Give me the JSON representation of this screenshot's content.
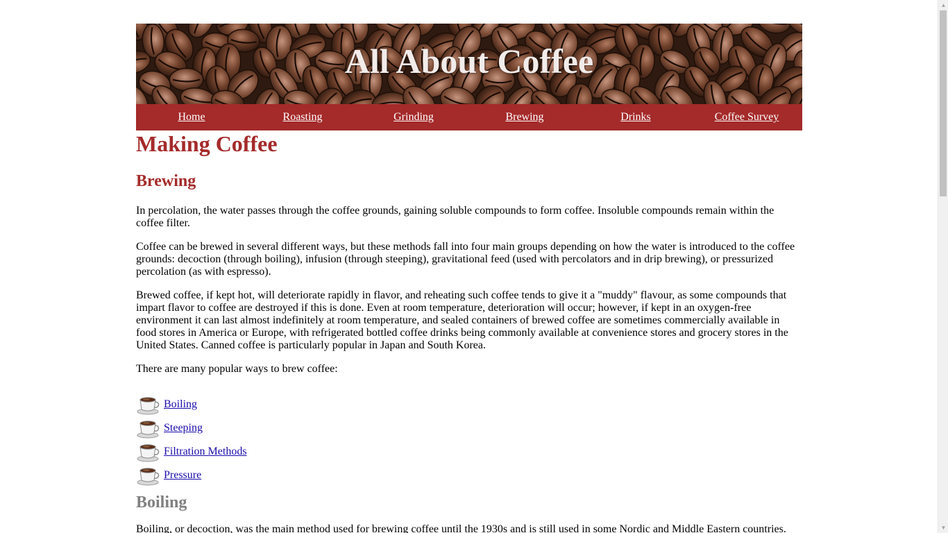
{
  "header": {
    "title": "All About Coffee"
  },
  "nav": {
    "items": [
      {
        "label": "Home"
      },
      {
        "label": "Roasting"
      },
      {
        "label": "Grinding"
      },
      {
        "label": "Brewing"
      },
      {
        "label": "Drinks"
      },
      {
        "label": "Coffee Survey"
      }
    ]
  },
  "main": {
    "title": "Making Coffee",
    "section_heading": "Brewing",
    "paragraphs": [
      "In percolation, the water passes through the coffee grounds, gaining soluble compounds to form coffee. Insoluble compounds remain within the coffee filter.",
      "Coffee can be brewed in several different ways, but these methods fall into four main groups depending on how the water is introduced to the coffee grounds: decoction (through boiling), infusion (through steeping), gravitational feed (used with percolators and in drip brewing), or pressurized percolation (as with espresso).",
      "Brewed coffee, if kept hot, will deteriorate rapidly in flavor, and reheating such coffee tends to give it a \"muddy\" flavour, as some compounds that impart flavor to coffee are destroyed if this is done. Even at room temperature, deterioration will occur; however, if kept in an oxygen-free environment it can last almost indefinitely at room temperature, and sealed containers of brewed coffee are sometimes commercially available in food stores in America or Europe, with refrigerated bottled coffee drinks being commonly available at convenience stores and grocery stores in the United States. Canned coffee is particularly popular in Japan and South Korea.",
      "There are many popular ways to brew coffee:"
    ],
    "methods": [
      {
        "label": "Boiling",
        "icon": "coffee-cup-icon"
      },
      {
        "label": "Steeping",
        "icon": "coffee-cup-icon"
      },
      {
        "label": "Filtration Methods",
        "icon": "coffee-cup-icon"
      },
      {
        "label": "Pressure",
        "icon": "coffee-cup-icon"
      }
    ],
    "subsection_heading": "Boiling",
    "subsection_text": "Boiling, or decoction, was the main method used for brewing coffee until the 1930s and is still used in some Nordic and Middle Eastern countries."
  },
  "colors": {
    "accent": "#a52a2a",
    "nav_text": "#ffffff",
    "link": "#1a0dab",
    "muted_heading": "#808080",
    "banner_title": "#f2ecea"
  }
}
